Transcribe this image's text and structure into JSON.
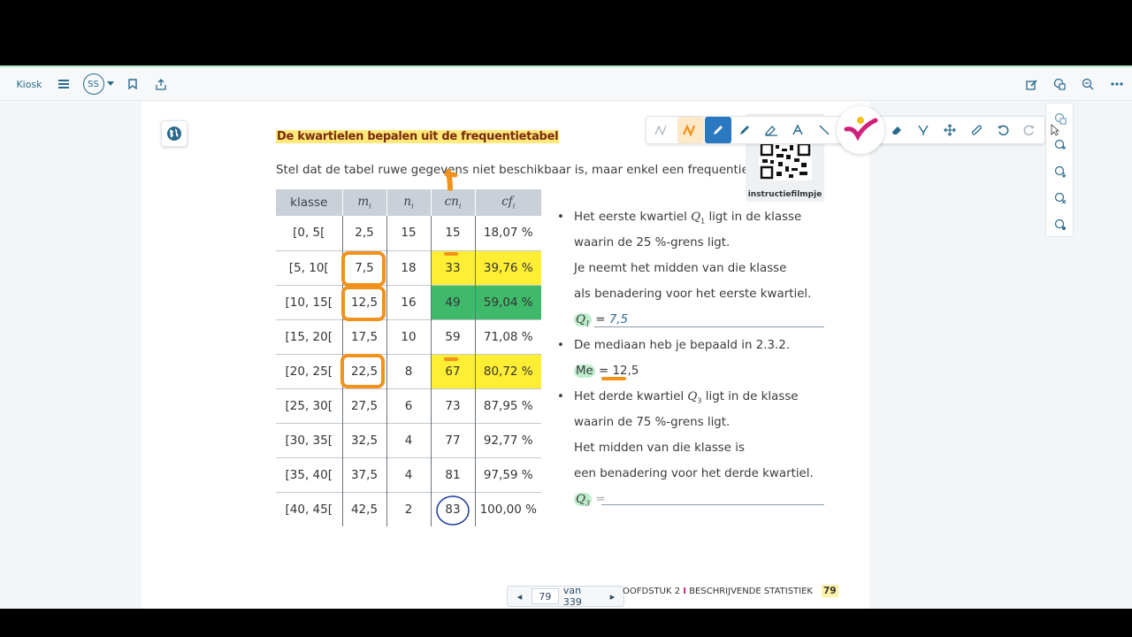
{
  "topbar": {
    "kiosk_label": "Kiosk",
    "avatar_initials": "SS"
  },
  "exercise": {
    "title": "De kwartielen bepalen uit de frequentietabel",
    "intro": "Stel dat de tabel ruwe gegevens niet beschikbaar is, maar enkel een frequentietabel."
  },
  "table": {
    "headers": [
      "klasse",
      "m",
      "n",
      "cn",
      "cf"
    ],
    "header_subscript": "i",
    "rows": [
      [
        "[0, 5[",
        "2,5",
        "15",
        "15",
        "18,07 %"
      ],
      [
        "[5, 10[",
        "7,5",
        "18",
        "33",
        "39,76 %"
      ],
      [
        "[10, 15[",
        "12,5",
        "16",
        "49",
        "59,04 %"
      ],
      [
        "[15, 20[",
        "17,5",
        "10",
        "59",
        "71,08 %"
      ],
      [
        "[20, 25[",
        "22,5",
        "8",
        "67",
        "80,72 %"
      ],
      [
        "[25, 30[",
        "27,5",
        "6",
        "73",
        "87,95 %"
      ],
      [
        "[30, 35[",
        "32,5",
        "4",
        "77",
        "92,77 %"
      ],
      [
        "[35, 40[",
        "37,5",
        "4",
        "81",
        "97,59 %"
      ],
      [
        "[40, 45[",
        "42,5",
        "2",
        "83",
        "100,00 %"
      ]
    ],
    "highlight_colors": {
      "yellow": "#ffee33",
      "green": "#3fba6a"
    }
  },
  "notes": {
    "q1_line1": "Het eerste kwartiel ",
    "q1_line1_var": "Q",
    "q1_line1_sub": "1",
    "q1_line1_end": " ligt in de klasse",
    "q1_line2": "waarin de 25 %-grens ligt.",
    "q1_line3": "Je neemt het midden van die klasse",
    "q1_line4": "als benadering voor het eerste kwartiel.",
    "q1_label": "Q",
    "q1_sub": "1",
    "q1_eq": " = ",
    "q1_answer": "7,5",
    "me_line": "De mediaan heb je bepaald in 2.3.2.",
    "me_label": "Me",
    "me_eq": " = ",
    "me_answer": "12,5",
    "q3_line1": "Het derde kwartiel ",
    "q3_line1_var": "Q",
    "q3_line1_sub": "3",
    "q3_line1_end": " ligt in de klasse",
    "q3_line2": "waarin de 75 %-grens ligt.",
    "q3_line3": "Het midden van die klasse is",
    "q3_line4": "een benadering voor het derde kwartiel.",
    "q3_label": "Q",
    "q3_sub": "3",
    "q3_eq": " ="
  },
  "qr": {
    "label": "instructiefilmpje"
  },
  "pager": {
    "current_page": "79",
    "of_label": "van 339"
  },
  "footer": {
    "chapter": "OOFDSTUK 2",
    "separator": "I",
    "section": "BESCHRIJVENDE STATISTIEK",
    "page_number": "79"
  },
  "colors": {
    "accent": "#2a6a8c",
    "ink_orange": "#f2921d",
    "ink_blue": "#1a3a9a",
    "brand_magenta": "#d0207a"
  }
}
